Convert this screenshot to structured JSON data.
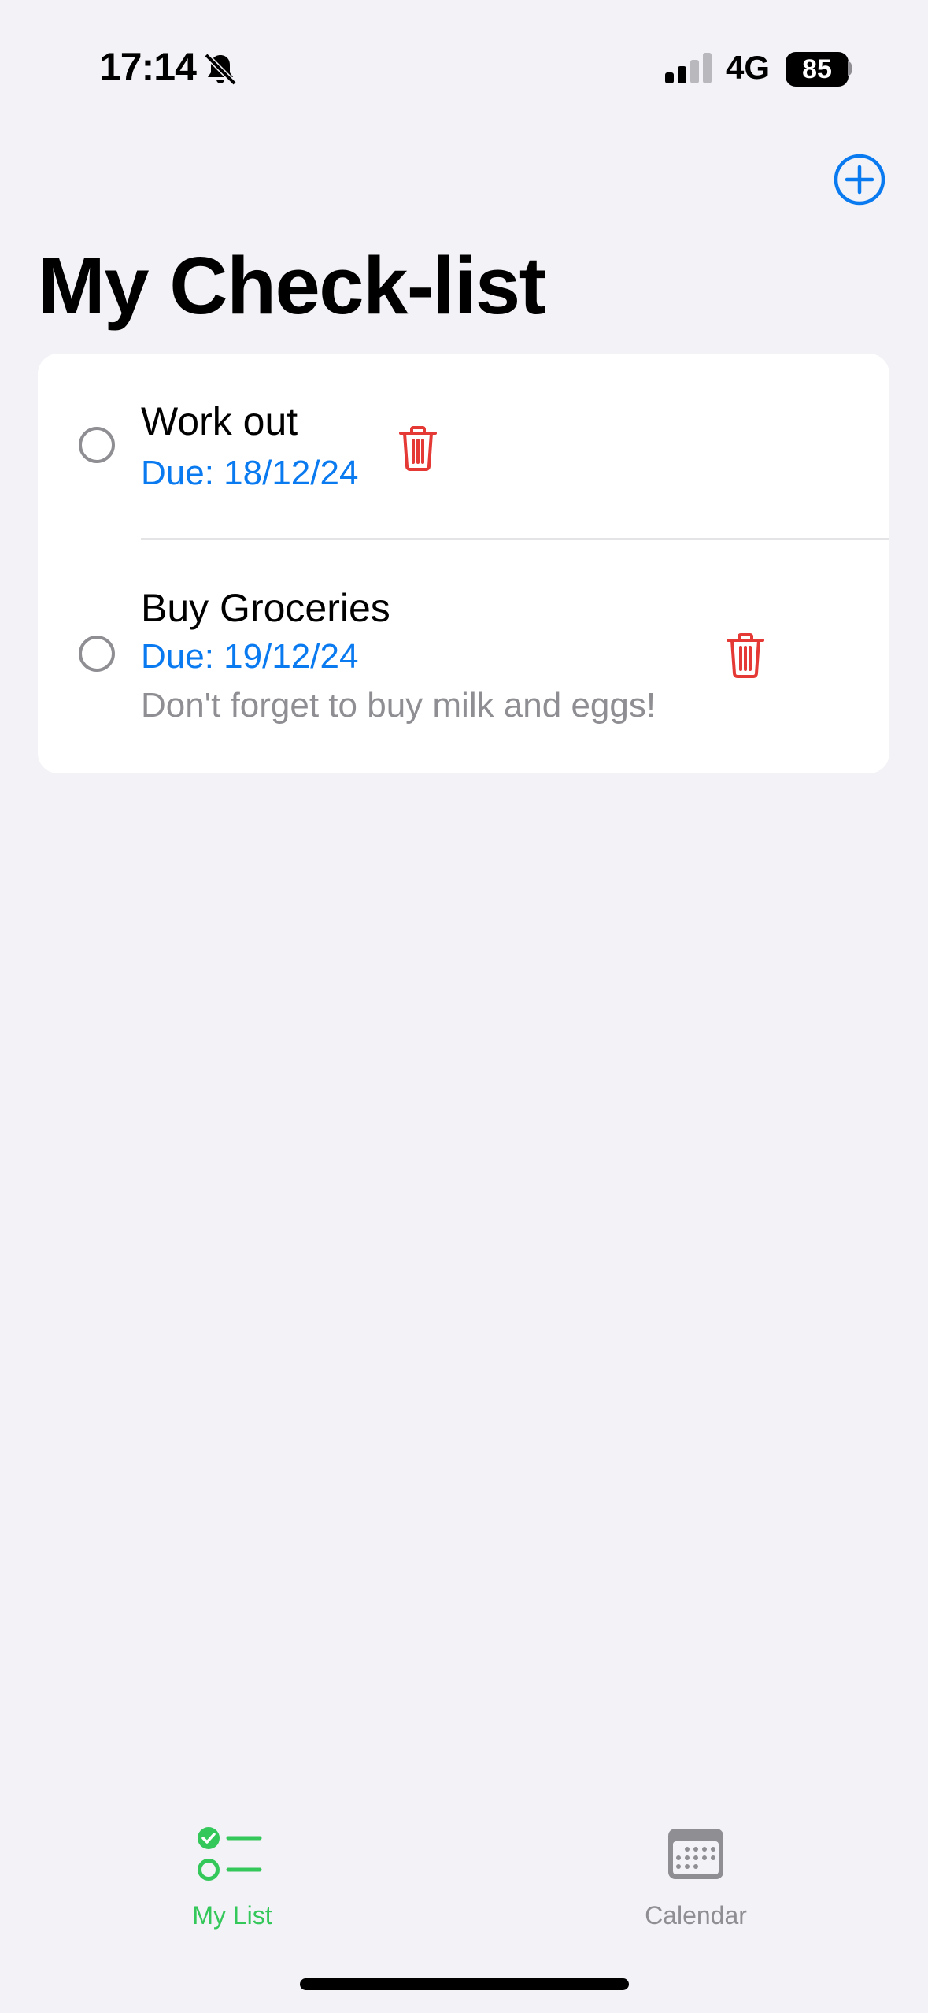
{
  "status_bar": {
    "time": "17:14",
    "network": "4G",
    "battery": "85",
    "icons": [
      "bell-slash-icon",
      "cellular-signal-icon",
      "battery-icon"
    ]
  },
  "header": {
    "add_icon": "plus-circle-icon",
    "title": "My Check-list"
  },
  "tasks": [
    {
      "title": "Work out",
      "due": "Due: 18/12/24",
      "note": ""
    },
    {
      "title": "Buy Groceries",
      "due": "Due: 19/12/24",
      "note": "Don't forget to buy milk and eggs!"
    }
  ],
  "tab_bar": {
    "tabs": [
      {
        "label": "My List",
        "icon": "checklist-icon",
        "selected": true
      },
      {
        "label": "Calendar",
        "icon": "calendar-icon",
        "selected": false
      }
    ]
  },
  "colors": {
    "background": "#F2F2F7",
    "accent_blue": "#0A7AF0",
    "delete_red": "#E53935",
    "selected_tab_green": "#34C759",
    "secondary_gray": "#8E8E93"
  }
}
